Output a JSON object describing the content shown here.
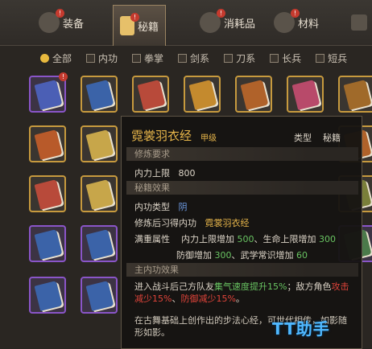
{
  "tabs": [
    {
      "label": "装备",
      "badge": "!",
      "icon": "armor-icon"
    },
    {
      "label": "秘籍",
      "badge": "!",
      "icon": "scroll-book-icon",
      "active": true
    },
    {
      "label": "消耗品",
      "badge": "!",
      "icon": "potion-icon"
    },
    {
      "label": "材料",
      "badge": "!",
      "icon": "herb-icon"
    }
  ],
  "filters": [
    "全部",
    "内功",
    "拳掌",
    "剑系",
    "刀系",
    "长兵",
    "短兵"
  ],
  "grid_badge": "!",
  "book_colors": [
    "#4b5fb5",
    "#3b63a8",
    "#b84a3a",
    "#c48a2e",
    "#b0622a",
    "#b84a6a",
    "#a06a2a",
    "#b85a2a",
    "#c7a64a"
  ],
  "tooltip": {
    "title": "霓裳羽衣经",
    "grade": "甲级",
    "type_label": "类型",
    "type_value": "秘籍",
    "section_req": "修炼要求",
    "req_label": "内力上限",
    "req_value": "800",
    "section_effect": "秘籍效果",
    "neigong_type_label": "内功类型",
    "neigong_type_value": "阴",
    "learn_label": "修炼后习得内功",
    "learn_value": "霓裳羽衣经",
    "full_label": "满重属性",
    "full_line1_a": "内力上限增加",
    "full_line1_b": "500",
    "full_line1_c": "、生命上限增加",
    "full_line1_d": "300",
    "full_line2_a": "防御增加",
    "full_line2_b": "300",
    "full_line2_c": "、武学常识增加",
    "full_line2_d": "60",
    "section_main": "主内功效果",
    "main_a": "进入战斗后己方队友",
    "main_b": "集气速度提升15%",
    "main_c": "；敌方角色",
    "main_d": "攻击减少15%",
    "main_e": "、",
    "main_f": "防御减少15%",
    "main_g": "。",
    "desc": "在古舞基础上创作出的步法心经，可世代相传，如影随形如影。",
    "desc_visible": "在古舞基础上创作出的步法心经，可世……"
  },
  "watermark": "TT助手"
}
